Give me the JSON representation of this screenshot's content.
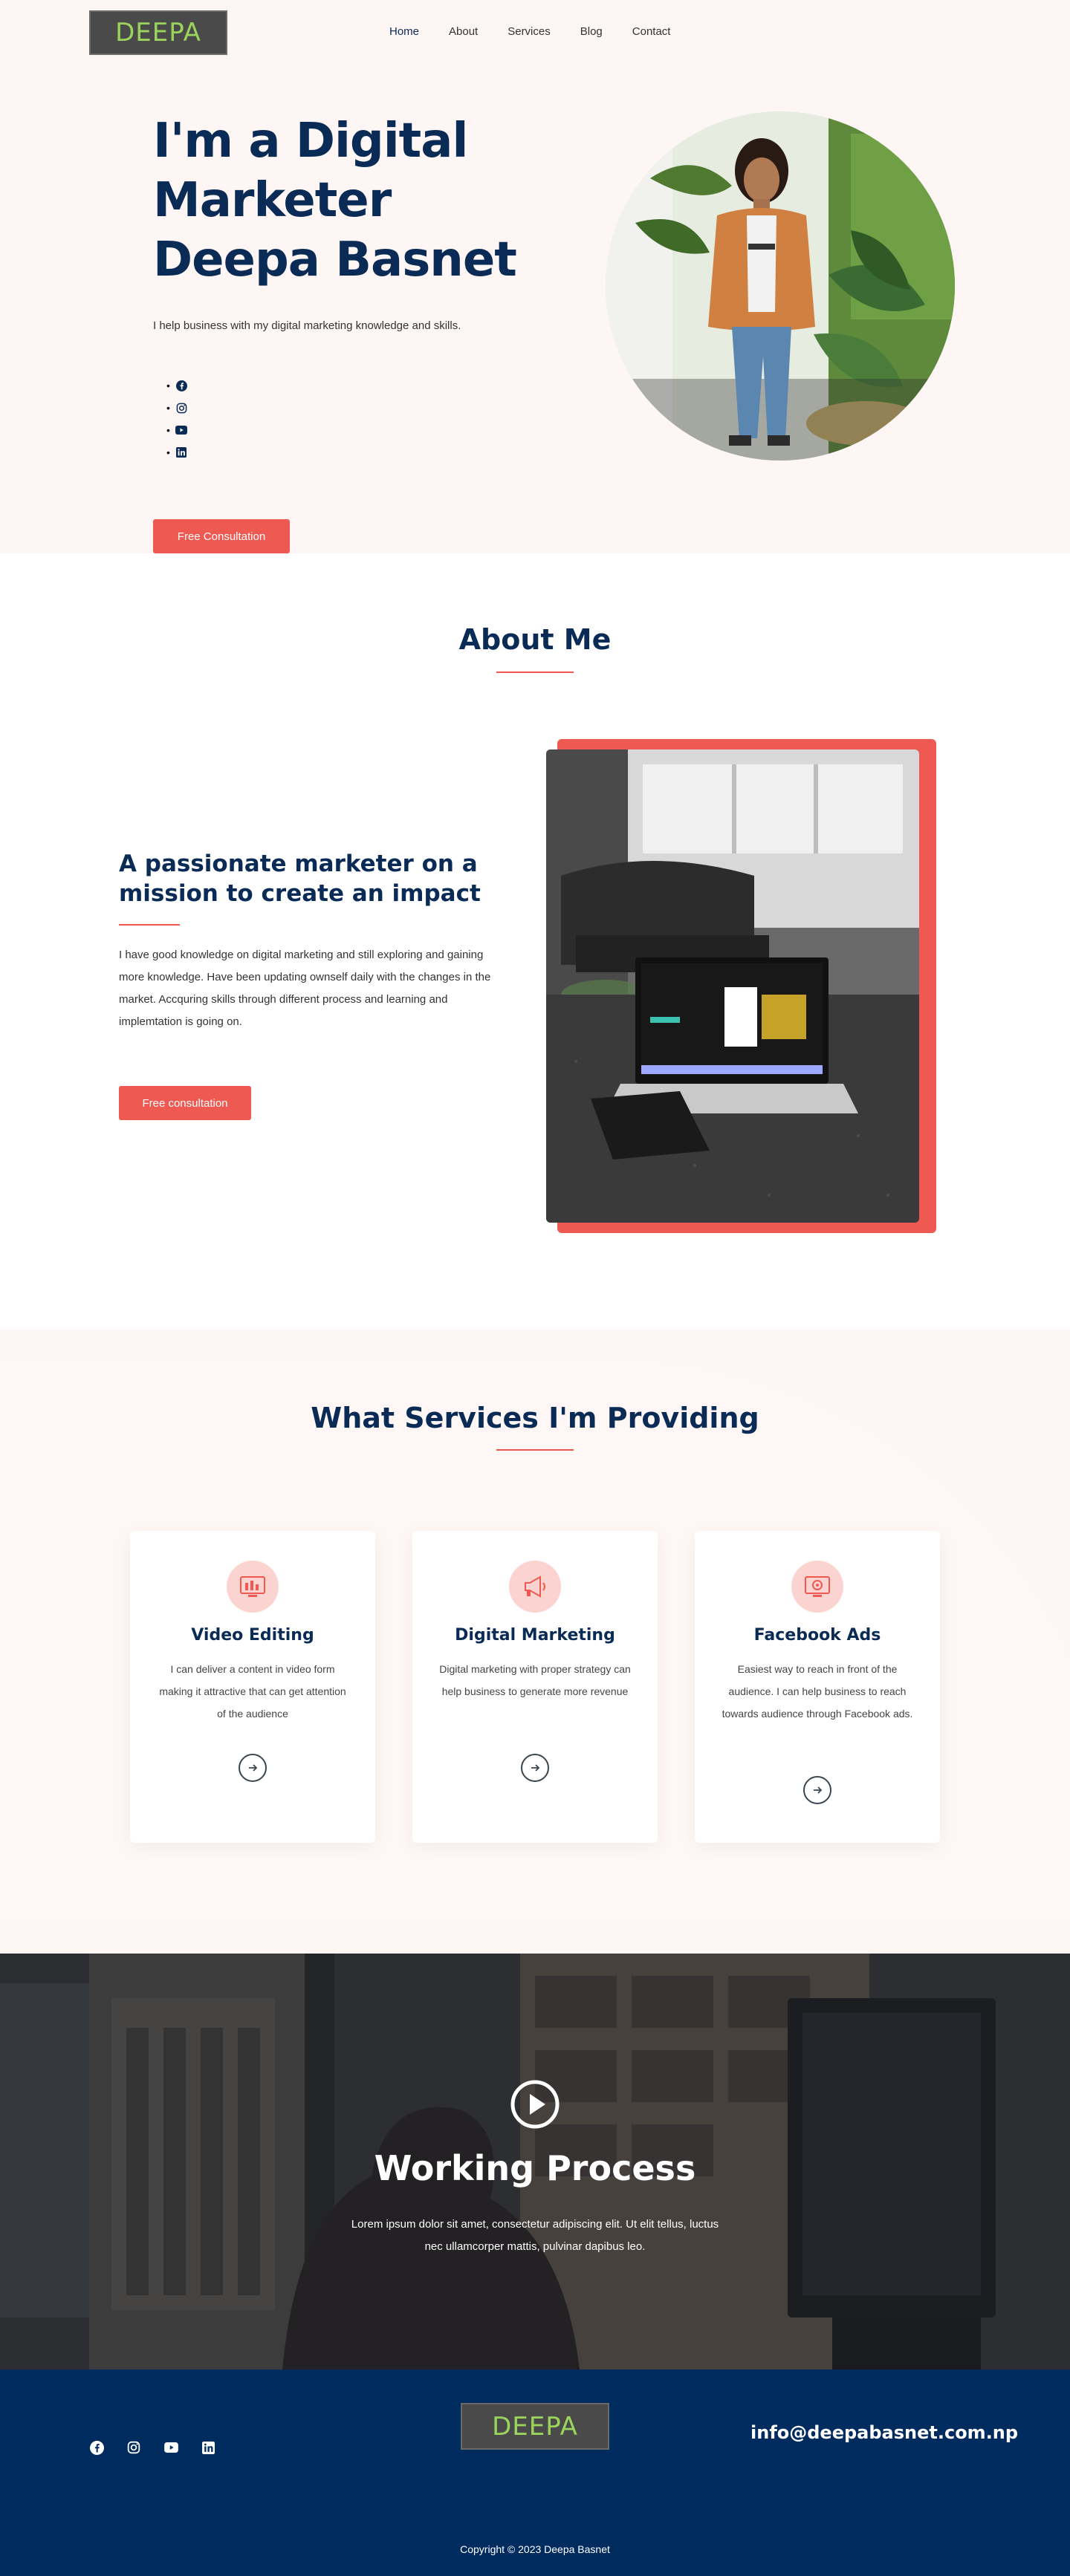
{
  "nav": {
    "logo": "DEEPA",
    "items": [
      {
        "label": "Home"
      },
      {
        "label": "About"
      },
      {
        "label": "Services"
      },
      {
        "label": "Blog"
      },
      {
        "label": "Contact"
      }
    ]
  },
  "hero": {
    "title": "I'm a Digital Marketer Deepa Basnet",
    "subtitle": "I help business  with my digital marketing knowledge and skills.",
    "socials": [
      "facebook-icon",
      "instagram-icon",
      "youtube-icon",
      "linkedin-icon"
    ],
    "button": "Free Consultation"
  },
  "about": {
    "title": "About Me",
    "heading": "A passionate marketer on a mission to create an impact",
    "paragraph": "I have good knowledge on digital marketing and still exploring and gaining more knowledge. Have been updating ownself daily with the changes in the market. Accquring skills through different process and learning and implemtation is going on.",
    "button": "Free consultation"
  },
  "services": {
    "title": "What Services I'm Providing",
    "cards": [
      {
        "title": "Video Editing",
        "text": "I can deliver a  content in video form making it attractive that can get attention of the audience",
        "icon": "video-editing-icon"
      },
      {
        "title": "Digital Marketing",
        "text": "Digital marketing with proper strategy can help business to generate more revenue",
        "icon": "megaphone-icon"
      },
      {
        "title": "Facebook Ads",
        "text": "Easiest way to reach in front of the audience. I can help   business to reach towards audience through Facebook ads.",
        "icon": "ads-monitor-icon"
      }
    ]
  },
  "process": {
    "title": "Working Process",
    "text": "Lorem ipsum dolor sit amet, consectetur adipiscing elit. Ut elit tellus, luctus nec ullamcorper mattis, pulvinar dapibus leo."
  },
  "footer": {
    "logo": "DEEPA",
    "email": "info@deepabasnet.com.np",
    "copyright": "Copyright © 2023 Deepa Basnet"
  },
  "colors": {
    "navy": "#0a2b55",
    "accent": "#ee5a52",
    "footer_bg": "#002b5e",
    "hero_bg": "#fdf6f4"
  }
}
